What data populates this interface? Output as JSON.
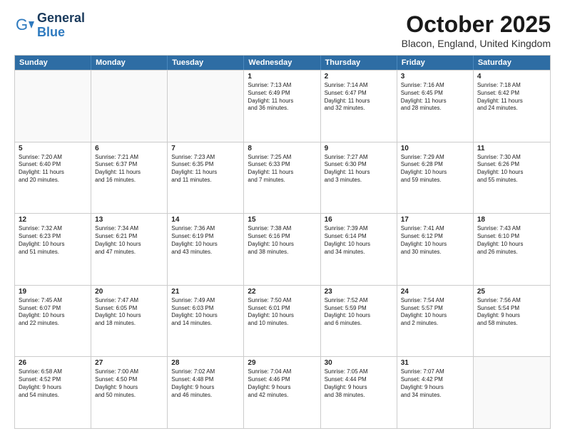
{
  "header": {
    "logo_general": "General",
    "logo_blue": "Blue",
    "month_title": "October 2025",
    "location": "Blacon, England, United Kingdom"
  },
  "days_of_week": [
    "Sunday",
    "Monday",
    "Tuesday",
    "Wednesday",
    "Thursday",
    "Friday",
    "Saturday"
  ],
  "rows": [
    [
      {
        "day": "",
        "info": "",
        "empty": true
      },
      {
        "day": "",
        "info": "",
        "empty": true
      },
      {
        "day": "",
        "info": "",
        "empty": true
      },
      {
        "day": "1",
        "info": "Sunrise: 7:13 AM\nSunset: 6:49 PM\nDaylight: 11 hours\nand 36 minutes."
      },
      {
        "day": "2",
        "info": "Sunrise: 7:14 AM\nSunset: 6:47 PM\nDaylight: 11 hours\nand 32 minutes."
      },
      {
        "day": "3",
        "info": "Sunrise: 7:16 AM\nSunset: 6:45 PM\nDaylight: 11 hours\nand 28 minutes."
      },
      {
        "day": "4",
        "info": "Sunrise: 7:18 AM\nSunset: 6:42 PM\nDaylight: 11 hours\nand 24 minutes."
      }
    ],
    [
      {
        "day": "5",
        "info": "Sunrise: 7:20 AM\nSunset: 6:40 PM\nDaylight: 11 hours\nand 20 minutes."
      },
      {
        "day": "6",
        "info": "Sunrise: 7:21 AM\nSunset: 6:37 PM\nDaylight: 11 hours\nand 16 minutes."
      },
      {
        "day": "7",
        "info": "Sunrise: 7:23 AM\nSunset: 6:35 PM\nDaylight: 11 hours\nand 11 minutes."
      },
      {
        "day": "8",
        "info": "Sunrise: 7:25 AM\nSunset: 6:33 PM\nDaylight: 11 hours\nand 7 minutes."
      },
      {
        "day": "9",
        "info": "Sunrise: 7:27 AM\nSunset: 6:30 PM\nDaylight: 11 hours\nand 3 minutes."
      },
      {
        "day": "10",
        "info": "Sunrise: 7:29 AM\nSunset: 6:28 PM\nDaylight: 10 hours\nand 59 minutes."
      },
      {
        "day": "11",
        "info": "Sunrise: 7:30 AM\nSunset: 6:26 PM\nDaylight: 10 hours\nand 55 minutes."
      }
    ],
    [
      {
        "day": "12",
        "info": "Sunrise: 7:32 AM\nSunset: 6:23 PM\nDaylight: 10 hours\nand 51 minutes."
      },
      {
        "day": "13",
        "info": "Sunrise: 7:34 AM\nSunset: 6:21 PM\nDaylight: 10 hours\nand 47 minutes."
      },
      {
        "day": "14",
        "info": "Sunrise: 7:36 AM\nSunset: 6:19 PM\nDaylight: 10 hours\nand 43 minutes."
      },
      {
        "day": "15",
        "info": "Sunrise: 7:38 AM\nSunset: 6:16 PM\nDaylight: 10 hours\nand 38 minutes."
      },
      {
        "day": "16",
        "info": "Sunrise: 7:39 AM\nSunset: 6:14 PM\nDaylight: 10 hours\nand 34 minutes."
      },
      {
        "day": "17",
        "info": "Sunrise: 7:41 AM\nSunset: 6:12 PM\nDaylight: 10 hours\nand 30 minutes."
      },
      {
        "day": "18",
        "info": "Sunrise: 7:43 AM\nSunset: 6:10 PM\nDaylight: 10 hours\nand 26 minutes."
      }
    ],
    [
      {
        "day": "19",
        "info": "Sunrise: 7:45 AM\nSunset: 6:07 PM\nDaylight: 10 hours\nand 22 minutes."
      },
      {
        "day": "20",
        "info": "Sunrise: 7:47 AM\nSunset: 6:05 PM\nDaylight: 10 hours\nand 18 minutes."
      },
      {
        "day": "21",
        "info": "Sunrise: 7:49 AM\nSunset: 6:03 PM\nDaylight: 10 hours\nand 14 minutes."
      },
      {
        "day": "22",
        "info": "Sunrise: 7:50 AM\nSunset: 6:01 PM\nDaylight: 10 hours\nand 10 minutes."
      },
      {
        "day": "23",
        "info": "Sunrise: 7:52 AM\nSunset: 5:59 PM\nDaylight: 10 hours\nand 6 minutes."
      },
      {
        "day": "24",
        "info": "Sunrise: 7:54 AM\nSunset: 5:57 PM\nDaylight: 10 hours\nand 2 minutes."
      },
      {
        "day": "25",
        "info": "Sunrise: 7:56 AM\nSunset: 5:54 PM\nDaylight: 9 hours\nand 58 minutes."
      }
    ],
    [
      {
        "day": "26",
        "info": "Sunrise: 6:58 AM\nSunset: 4:52 PM\nDaylight: 9 hours\nand 54 minutes."
      },
      {
        "day": "27",
        "info": "Sunrise: 7:00 AM\nSunset: 4:50 PM\nDaylight: 9 hours\nand 50 minutes."
      },
      {
        "day": "28",
        "info": "Sunrise: 7:02 AM\nSunset: 4:48 PM\nDaylight: 9 hours\nand 46 minutes."
      },
      {
        "day": "29",
        "info": "Sunrise: 7:04 AM\nSunset: 4:46 PM\nDaylight: 9 hours\nand 42 minutes."
      },
      {
        "day": "30",
        "info": "Sunrise: 7:05 AM\nSunset: 4:44 PM\nDaylight: 9 hours\nand 38 minutes."
      },
      {
        "day": "31",
        "info": "Sunrise: 7:07 AM\nSunset: 4:42 PM\nDaylight: 9 hours\nand 34 minutes."
      },
      {
        "day": "",
        "info": "",
        "empty": true
      }
    ]
  ]
}
